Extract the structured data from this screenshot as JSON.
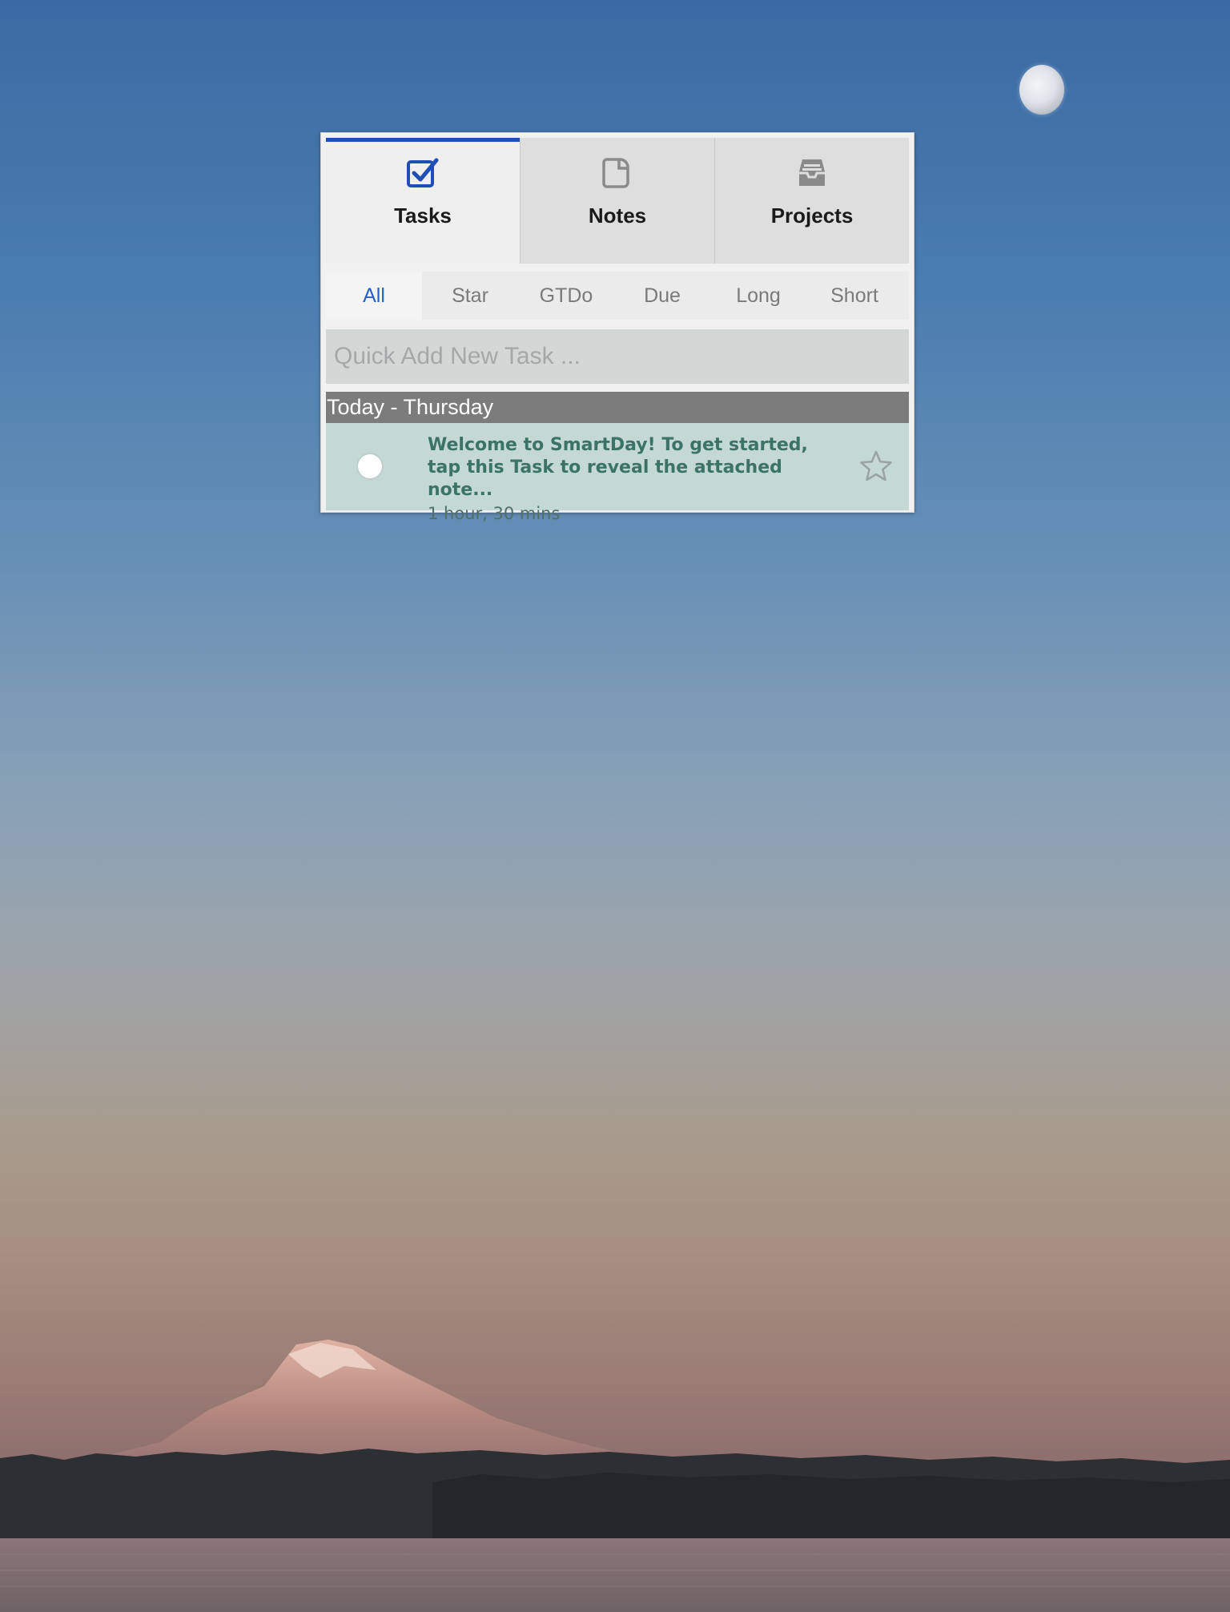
{
  "tabs": [
    {
      "label": "Tasks",
      "icon": "checkbox-icon",
      "active": true
    },
    {
      "label": "Notes",
      "icon": "note-icon",
      "active": false
    },
    {
      "label": "Projects",
      "icon": "inbox-tray-icon",
      "active": false
    }
  ],
  "filters": [
    {
      "label": "All",
      "active": true
    },
    {
      "label": "Star",
      "active": false
    },
    {
      "label": "GTDo",
      "active": false
    },
    {
      "label": "Due",
      "active": false
    },
    {
      "label": "Long",
      "active": false
    },
    {
      "label": "Short",
      "active": false
    }
  ],
  "quick_add": {
    "placeholder": "Quick Add New Task ..."
  },
  "section": {
    "title": "Today - Thursday"
  },
  "task": {
    "title": "Welcome to SmartDay! To get started, tap this Task to reveal the attached note...",
    "duration": "1 hour, 30 mins",
    "starred": false
  },
  "colors": {
    "accent": "#1f4fb4",
    "active_filter": "#2a5fc4",
    "task_background": "#c4d8d4",
    "task_text": "#3b7466",
    "section_header": "#7c7c7c"
  }
}
